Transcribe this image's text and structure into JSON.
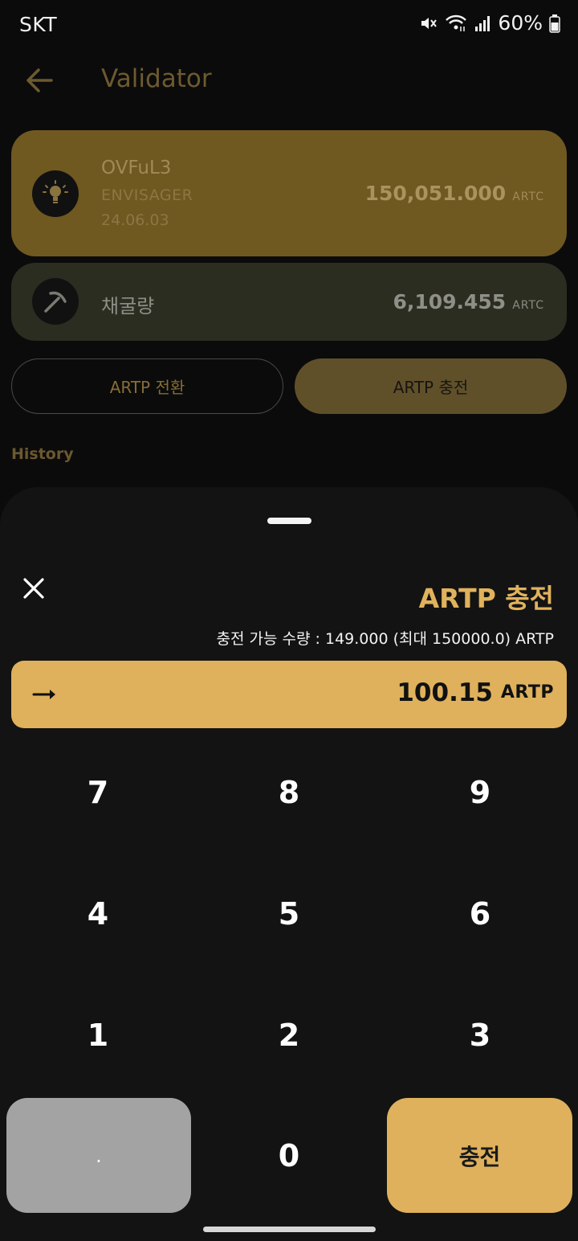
{
  "status_bar": {
    "carrier": "SKT",
    "battery": "60%"
  },
  "header": {
    "title": "Validator"
  },
  "validator_card": {
    "name": "OVFuL3",
    "type": "ENVISAGER",
    "date": "24.06.03",
    "amount": "150,051.000",
    "unit": "ARTC"
  },
  "mining_card": {
    "label": "채굴량",
    "amount": "6,109.455",
    "unit": "ARTC"
  },
  "actions": {
    "convert_label": "ARTP 전환",
    "charge_label": "ARTP 충전"
  },
  "history": {
    "label": "History"
  },
  "sheet": {
    "title": "ARTP 충전",
    "available_text": "충전 가능 수량 : 149.000 (최대 150000.0) ARTP",
    "input_value": "100.15",
    "input_unit": "ARTP",
    "keys": [
      "7",
      "8",
      "9",
      "4",
      "5",
      "6",
      "1",
      "2",
      "3"
    ],
    "key_dot": ".",
    "key_zero": "0",
    "charge_button": "충전"
  },
  "colors": {
    "accent": "#dfb15c",
    "sheet_bg": "#131313",
    "dot_key": "#a3a3a3"
  },
  "icons": {
    "back": "arrow-left-icon",
    "close": "close-icon",
    "bulb": "lightbulb-icon",
    "pickaxe": "pickaxe-icon",
    "input_arrow": "arrow-right-icon"
  }
}
